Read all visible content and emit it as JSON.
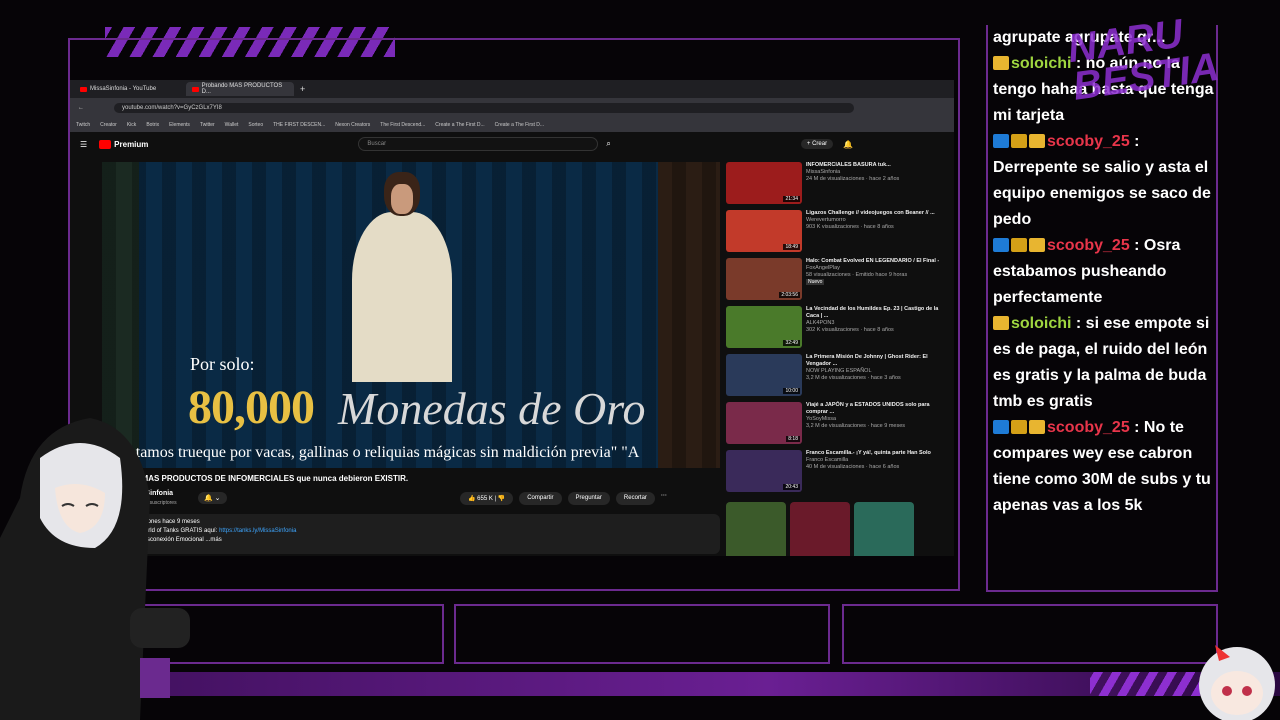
{
  "browser": {
    "tabs": [
      {
        "label": "MissaSinfonia - YouTube"
      },
      {
        "label": "Probando MAS PRODUCTOS D..."
      }
    ],
    "url": "youtube.com/watch?v=GyCzGLx7YI8",
    "bookmarks": [
      "Twitch",
      "Creator",
      "Kick",
      "Botrix",
      "Elements",
      "Twitter",
      "Wallet",
      "Sorteo",
      "THE FIRST DESCEN...",
      "Nexon Creators",
      "The First Descend...",
      "Create a The First D...",
      "Create a The First D..."
    ]
  },
  "youtube": {
    "logo": "Premium",
    "search_placeholder": "Buscar",
    "create_label": "Crear",
    "video": {
      "overlay_line1": "Por solo:",
      "overlay_price": "80,000",
      "overlay_rest": "Monedas de Oro",
      "subtitle": "Aceptamos trueque por vacas, gallinas o reliquias mágicas sin maldición previa\" \"A"
    },
    "title": "Probando MAS PRODUCTOS DE INFOMERCIALES que nunca debieron EXISTIR.",
    "channel": "MissaSinfonia",
    "subscribers": "20,1 M de suscriptores",
    "likes": "655 K",
    "actions": [
      "Compartir",
      "Preguntar",
      "Recortar"
    ],
    "description": {
      "views": "de visualizaciones  hace 9 meses",
      "line2": "Descarga World of Tanks GRATIS aquí:",
      "link": "https://tanks.ly/MissaSinfonia",
      "line3": "...re Save Desconexión Emocional    ...más"
    },
    "recommended": [
      {
        "title": "INFOMERCIALES BASURA tuk...",
        "channel": "MissaSinfonia",
        "meta": "24 M de visualizaciones · hace 2 años",
        "duration": "21:34",
        "color": "#9c1c1c"
      },
      {
        "title": "Ligazos Challenge // videojuegos con Beaner // ...",
        "channel": "Werevertumorro",
        "meta": "903 K visualizaciones · hace 8 años",
        "duration": "18:49",
        "color": "#c23a2a"
      },
      {
        "title": "Halo: Combat Evolved EN LEGENDARIO / El Final -",
        "channel": "FoxAngelPlay",
        "meta": "58 visualizaciones · Emitido hace 9 horas",
        "duration": "2:03:56",
        "badge": "Nuevo",
        "color": "#7a3a2a"
      },
      {
        "title": "La Vecindad de los Humildes Ep. 23 | Castigo de la Caca | ...",
        "channel": "ALK4PON3",
        "meta": "302 K visualizaciones · hace 8 años",
        "duration": "32:49",
        "color": "#4a7a2a"
      },
      {
        "title": "La Primera Misión De Johnny | Ghost Rider: El Vengador ...",
        "channel": "NOW PLAYING ESPAÑOL",
        "meta": "3,2 M de visualizaciones · hace 3 años",
        "duration": "10:00",
        "color": "#2a3a5a"
      },
      {
        "title": "Viajé a JAPÓN y a ESTADOS UNIDOS solo para comprar ...",
        "channel": "YoSoyMissa",
        "meta": "3,2 M de visualizaciones · hace 9 meses",
        "duration": "8:18",
        "color": "#7a2a4a"
      },
      {
        "title": "Franco Escamilla.- ¡Y yá!, quinta parte Han Solo",
        "channel": "Franco Escamilla",
        "meta": "40 M de visualizaciones · hace 6 años",
        "duration": "20:43",
        "color": "#3a2a5a"
      }
    ]
  },
  "chat": {
    "messages": [
      {
        "user": "",
        "text": "agrupate agrupate gr...",
        "badges": []
      },
      {
        "user": "soloichi",
        "text": ": no aún no la tengo hahaa hasta que tenga mi tarjeta",
        "user_color": "green",
        "badges": [
          "crown"
        ]
      },
      {
        "user": "scooby_25",
        "text": ": Derrepente se salio y asta el equipo enemigos se saco de pedo",
        "user_color": "red",
        "badges": [
          "blue",
          "gold",
          "crown"
        ]
      },
      {
        "user": "scooby_25",
        "text": ": Osra estabamos pusheando perfectamente",
        "user_color": "red",
        "badges": [
          "blue",
          "gold",
          "crown"
        ]
      },
      {
        "user": "soloichi",
        "text": ": si ese empote si es de paga, el ruido del león es gratis y la palma de buda tmb es gratis",
        "user_color": "green",
        "badges": [
          "crown"
        ]
      },
      {
        "user": "scooby_25",
        "text": ": No te compares wey ese cabron tiene como 30M de subs y tu apenas vas a los 5k",
        "user_color": "red",
        "badges": [
          "blue",
          "gold",
          "crown"
        ]
      }
    ]
  },
  "brand": {
    "line1": "NARU",
    "line2": "BESTIA",
    "accent": "#6b2a8f"
  }
}
